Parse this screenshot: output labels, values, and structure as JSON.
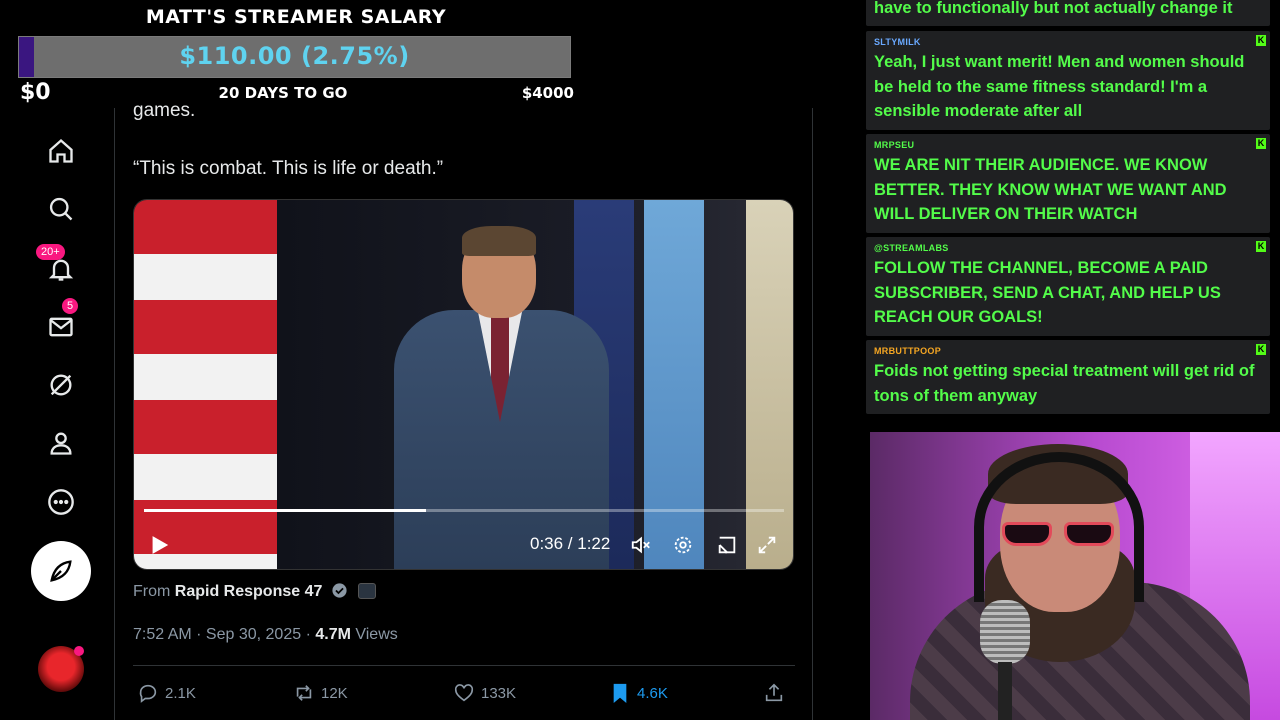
{
  "salary": {
    "title": "MATT'S STREAMER SALARY",
    "amount": "$110.00 (2.75%)",
    "min": "$0",
    "days": "20 DAYS TO GO",
    "max": "$4000",
    "progress_fraction": 0.0275,
    "bar_color": "#3a1680",
    "amount_color": "#5fd3f0"
  },
  "nav": {
    "notifications_badge": "20+",
    "messages_badge": "5",
    "icons": [
      "home-icon",
      "search-icon",
      "bell-icon",
      "mail-icon",
      "grok-icon",
      "profile-icon",
      "more-icon",
      "compose-icon"
    ]
  },
  "tweet": {
    "cut_text": "games.",
    "quote": "“This is combat. This is life or death.”",
    "video": {
      "time": "0:36 / 1:22",
      "progress_fraction": 0.44
    },
    "source_prefix": "From",
    "source_name": "Rapid Response 47",
    "meta_time": "7:52 AM · Sep 30, 2025 · ",
    "views_count": "4.7M",
    "views_label": " Views",
    "actions": {
      "replies": "2.1K",
      "reposts": "12K",
      "likes": "133K",
      "bookmarks": "4.6K"
    },
    "accent": "#1d9bf0"
  },
  "chat": {
    "top_fragment": "have to functionally but not actually change it",
    "messages": [
      {
        "user": "SLTYMILK",
        "user_color": "#6aa9ff",
        "text": "Yeah, I just want merit! Men and women should be held to the same fitness standard! I'm a sensible moderate after all"
      },
      {
        "user": "MRPSEU",
        "user_color": "#53fc4a",
        "text": "WE ARE NIT THEIR AUDIENCE. WE KNOW BETTER. THEY KNOW WHAT WE WANT AND WILL DELIVER ON THEIR WATCH"
      },
      {
        "user": "@STREAMLABS",
        "user_color": "#53fc4a",
        "text": "FOLLOW THE CHANNEL, BECOME A PAID SUBSCRIBER, SEND A CHAT, AND HELP US REACH OUR GOALS!"
      },
      {
        "user": "MRBUTTPOOP",
        "user_color": "#f5a623",
        "text": "Foids not getting special treatment will get rid of tons of them anyway"
      }
    ],
    "platform_badge": "K",
    "text_color": "#53fc4a"
  }
}
